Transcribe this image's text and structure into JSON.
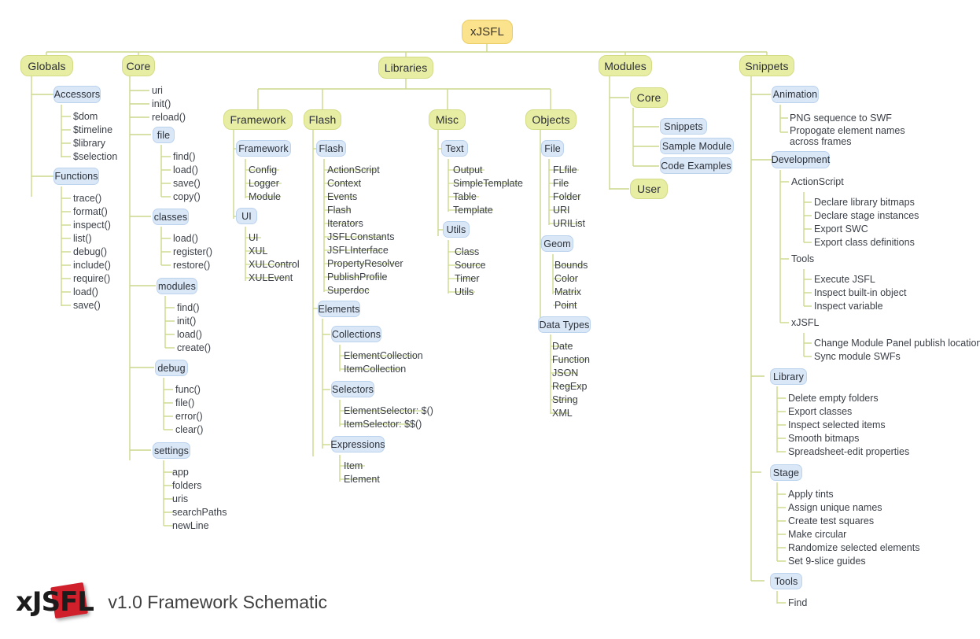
{
  "footer": {
    "logo_prefix": "xJS",
    "logo_suffix": "FL",
    "caption": "v1.0 Framework Schematic"
  },
  "colors": {
    "root_fill": "#fbe38d",
    "branch_fill": "#e8eda4",
    "leaf_fill": "#d9e7f7",
    "wire": "#ccd98c",
    "accent_red": "#d0202c"
  },
  "root": {
    "label": "xJSFL"
  },
  "columns": {
    "globals": {
      "label": "Globals",
      "groups": [
        {
          "label": "Accessors",
          "items": [
            "$dom",
            "$timeline",
            "$library",
            "$selection"
          ]
        },
        {
          "label": "Functions",
          "items": [
            "trace()",
            "format()",
            "inspect()",
            "list()",
            "debug()",
            "include()",
            "require()",
            "load()",
            "save()"
          ]
        }
      ]
    },
    "core": {
      "label": "Core",
      "direct_items": [
        "uri",
        "init()",
        "reload()"
      ],
      "groups": [
        {
          "label": "file",
          "items": [
            "find()",
            "load()",
            "save()",
            "copy()"
          ]
        },
        {
          "label": "classes",
          "items": [
            "load()",
            "register()",
            "restore()"
          ]
        },
        {
          "label": "modules",
          "items": [
            "find()",
            "init()",
            "load()",
            "create()"
          ]
        },
        {
          "label": "debug",
          "items": [
            "func()",
            "file()",
            "error()",
            "clear()"
          ]
        },
        {
          "label": "settings",
          "items": [
            "app",
            "folders",
            "uris",
            "searchPaths",
            "newLine"
          ]
        }
      ]
    },
    "libraries": {
      "label": "Libraries",
      "sections": [
        {
          "label": "Framework",
          "groups": [
            {
              "label": "Framework",
              "items": [
                "Config",
                "Logger",
                "Module"
              ]
            },
            {
              "label": "UI",
              "items": [
                "UI",
                "XUL",
                "XULControl",
                "XULEvent"
              ]
            }
          ]
        },
        {
          "label": "Flash",
          "groups": [
            {
              "label": "Flash",
              "items": [
                "ActionScript",
                "Context",
                "Events",
                "Flash",
                "Iterators",
                "JSFLConstants",
                "JSFLInterface",
                "PropertyResolver",
                "PublishProfile",
                "Superdoc"
              ]
            },
            {
              "label": "Elements",
              "items": []
            },
            {
              "label": "Collections",
              "items": [
                "ElementCollection",
                "ItemCollection"
              ]
            },
            {
              "label": "Selectors",
              "items": [
                "ElementSelector: $()",
                "ItemSelector: $$()"
              ]
            },
            {
              "label": "Expressions",
              "items": [
                "Item",
                "Element"
              ]
            }
          ]
        },
        {
          "label": "Misc",
          "groups": [
            {
              "label": "Text",
              "items": [
                "Output",
                "SimpleTemplate",
                "Table",
                "Template"
              ]
            },
            {
              "label": "Utils",
              "items": [
                "Class",
                "Source",
                "Timer",
                "Utils"
              ]
            }
          ]
        },
        {
          "label": "Objects",
          "groups": [
            {
              "label": "File",
              "items": [
                "FLfile",
                "File",
                "Folder",
                "URI",
                "URIList"
              ]
            },
            {
              "label": "Geom",
              "items": [
                "Bounds",
                "Color",
                "Matrix",
                "Point"
              ]
            },
            {
              "label": "Data Types",
              "items": [
                "Date",
                "Function",
                "JSON",
                "RegExp",
                "String",
                "XML"
              ]
            }
          ]
        }
      ]
    },
    "modules": {
      "label": "Modules",
      "groups": [
        {
          "label": "Core",
          "items": [
            "Snippets",
            "Sample Module",
            "Code Examples"
          ]
        },
        {
          "label": "User",
          "items": []
        }
      ]
    },
    "snippets": {
      "label": "Snippets",
      "groups": [
        {
          "label": "Animation",
          "items": [
            "PNG sequence to SWF",
            "Propogate element names across frames"
          ]
        },
        {
          "label": "Development",
          "subgroups": [
            {
              "label": "ActionScript",
              "items": [
                "Declare library bitmaps",
                "Declare stage instances",
                "Export SWC",
                "Export class definitions"
              ]
            },
            {
              "label": "Tools",
              "items": [
                "Execute JSFL",
                "Inspect built-in object",
                "Inspect variable"
              ]
            },
            {
              "label": "xJSFL",
              "items": [
                "Change Module Panel publish location",
                "Sync module SWFs"
              ]
            }
          ]
        },
        {
          "label": "Library",
          "items": [
            "Delete empty folders",
            "Export classes",
            "Inspect selected items",
            "Smooth bitmaps",
            "Spreadsheet-edit properties"
          ]
        },
        {
          "label": "Stage",
          "items": [
            "Apply tints",
            "Assign unique names",
            "Create test squares",
            "Make circular",
            "Randomize selected elements",
            "Set 9-slice guides"
          ]
        },
        {
          "label": "Tools",
          "items": [
            "Find"
          ]
        }
      ]
    }
  }
}
